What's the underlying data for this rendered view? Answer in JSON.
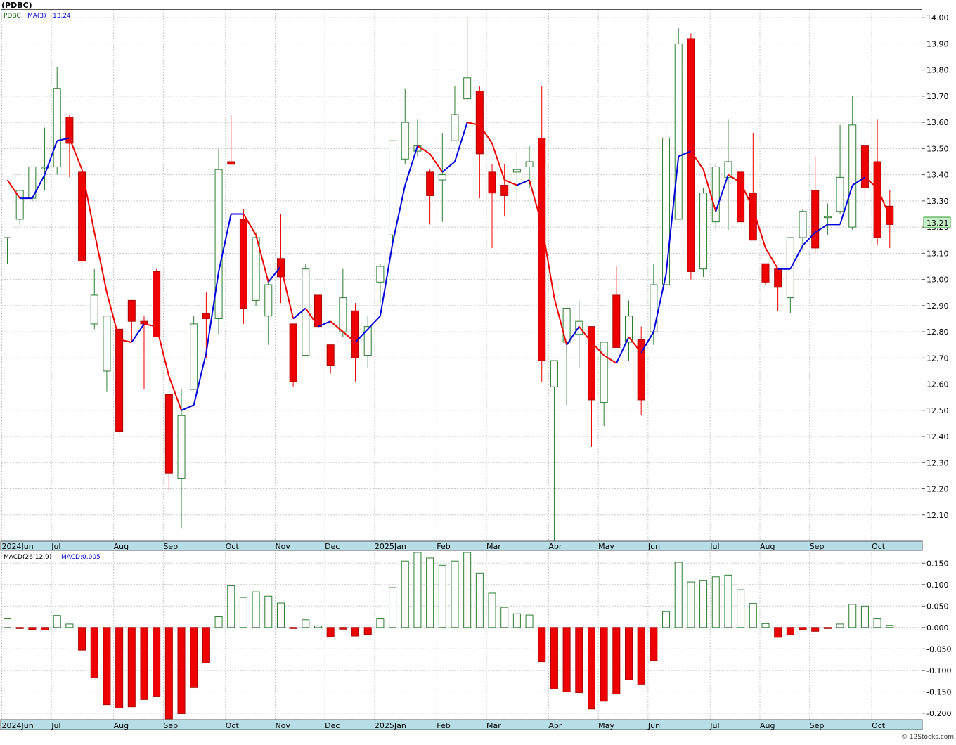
{
  "header": {
    "symbol_title": "(PDBC)"
  },
  "legend": {
    "symbol": "PDBC",
    "ma_label": "MA(3)",
    "ma_value": "13.24"
  },
  "macd_legend": {
    "params_label": "MACD(26,12,9)",
    "value_label": "MACD:0.005"
  },
  "last_price_label": "13.21",
  "watermark": "© 12Stocks.com",
  "colors": {
    "up": "#2e7d32",
    "down": "#ee0000",
    "ma_up": "#0000dd",
    "ma_down": "#ee0000",
    "axis_bar": "#b7dde6",
    "price_tag_bg": "#c8f0c8"
  },
  "chart_data": [
    {
      "type": "candlestick",
      "name": "price",
      "ylim": [
        12.0,
        14.03
      ],
      "y_ticks": [
        "14.00",
        "13.90",
        "13.80",
        "13.70",
        "13.60",
        "13.50",
        "13.40",
        "13.30",
        "13.20",
        "13.10",
        "13.00",
        "12.90",
        "12.80",
        "12.70",
        "12.60",
        "12.50",
        "12.40",
        "12.30",
        "12.20",
        "12.10"
      ],
      "x_labels": [
        {
          "label": "2024Jun",
          "i": 0
        },
        {
          "label": "Jul",
          "i": 4
        },
        {
          "label": "Aug",
          "i": 9
        },
        {
          "label": "Sep",
          "i": 13
        },
        {
          "label": "Oct",
          "i": 18
        },
        {
          "label": "Nov",
          "i": 22
        },
        {
          "label": "Dec",
          "i": 26
        },
        {
          "label": "2025Jan",
          "i": 30
        },
        {
          "label": "Feb",
          "i": 35
        },
        {
          "label": "Mar",
          "i": 39
        },
        {
          "label": "Apr",
          "i": 44
        },
        {
          "label": "May",
          "i": 48
        },
        {
          "label": "Jun",
          "i": 52
        },
        {
          "label": "Jul",
          "i": 57
        },
        {
          "label": "Aug",
          "i": 61
        },
        {
          "label": "Sep",
          "i": 65
        },
        {
          "label": "Oct",
          "i": 70
        }
      ],
      "candles": [
        [
          13.16,
          13.43,
          13.06,
          13.43
        ],
        [
          13.23,
          13.34,
          13.21,
          13.34
        ],
        [
          13.31,
          13.43,
          13.3,
          13.43
        ],
        [
          13.43,
          13.58,
          13.34,
          13.43
        ],
        [
          13.43,
          13.81,
          13.4,
          13.73
        ],
        [
          13.62,
          13.63,
          13.39,
          13.52
        ],
        [
          13.41,
          13.41,
          13.04,
          13.07
        ],
        [
          12.83,
          13.04,
          12.81,
          12.94
        ],
        [
          12.65,
          12.86,
          12.57,
          12.86
        ],
        [
          12.81,
          12.81,
          12.41,
          12.42
        ],
        [
          12.92,
          12.84,
          12.76,
          12.84
        ],
        [
          12.84,
          12.86,
          12.58,
          12.83
        ],
        [
          13.03,
          13.04,
          12.78,
          12.78
        ],
        [
          12.56,
          12.56,
          12.19,
          12.26
        ],
        [
          12.24,
          12.58,
          12.05,
          12.48
        ],
        [
          12.58,
          12.86,
          12.58,
          12.83
        ],
        [
          12.87,
          12.95,
          12.7,
          12.85
        ],
        [
          12.85,
          13.5,
          12.79,
          13.42
        ],
        [
          13.45,
          13.63,
          13.45,
          13.44
        ],
        [
          13.23,
          13.27,
          12.83,
          12.89
        ],
        [
          12.92,
          13.18,
          12.9,
          13.16
        ],
        [
          12.86,
          12.99,
          12.75,
          12.98
        ],
        [
          13.08,
          13.25,
          12.91,
          13.01
        ],
        [
          12.83,
          12.83,
          12.59,
          12.61
        ],
        [
          12.71,
          13.06,
          12.71,
          13.04
        ],
        [
          12.94,
          12.94,
          12.81,
          12.82
        ],
        [
          12.75,
          12.75,
          12.64,
          12.67
        ],
        [
          12.8,
          13.04,
          12.78,
          12.93
        ],
        [
          12.88,
          12.91,
          12.61,
          12.7
        ],
        [
          12.71,
          12.86,
          12.66,
          12.82
        ],
        [
          12.99,
          13.06,
          12.91,
          13.05
        ],
        [
          13.17,
          13.51,
          13.13,
          13.53
        ],
        [
          13.46,
          13.73,
          13.44,
          13.6
        ],
        [
          13.49,
          13.61,
          13.47,
          13.51
        ],
        [
          13.41,
          13.42,
          13.21,
          13.32
        ],
        [
          13.38,
          13.56,
          13.22,
          13.4
        ],
        [
          13.53,
          13.74,
          13.57,
          13.63
        ],
        [
          13.69,
          14.0,
          13.68,
          13.77
        ],
        [
          13.72,
          13.74,
          13.31,
          13.48
        ],
        [
          13.41,
          13.44,
          13.12,
          13.33
        ],
        [
          13.36,
          13.44,
          13.24,
          13.32
        ],
        [
          13.41,
          13.49,
          13.3,
          13.42
        ],
        [
          13.43,
          13.51,
          13.35,
          13.45
        ],
        [
          13.54,
          13.74,
          12.61,
          12.69
        ],
        [
          12.59,
          12.59,
          12.0,
          12.69
        ],
        [
          12.76,
          12.89,
          12.52,
          12.89
        ],
        [
          12.79,
          12.92,
          12.66,
          12.84
        ],
        [
          12.82,
          12.82,
          12.36,
          12.54
        ],
        [
          12.53,
          12.76,
          12.44,
          12.76
        ],
        [
          12.94,
          13.05,
          12.74,
          12.74
        ],
        [
          12.76,
          12.92,
          12.69,
          12.86
        ],
        [
          12.77,
          12.82,
          12.48,
          12.54
        ],
        [
          12.8,
          13.06,
          12.75,
          12.98
        ],
        [
          12.98,
          13.6,
          12.94,
          13.54
        ],
        [
          13.23,
          13.96,
          13.31,
          13.9
        ],
        [
          13.92,
          13.94,
          13.0,
          13.03
        ],
        [
          13.04,
          13.35,
          13.01,
          13.33
        ],
        [
          13.22,
          13.44,
          13.19,
          13.43
        ],
        [
          13.39,
          13.61,
          13.19,
          13.45
        ],
        [
          13.41,
          13.41,
          13.22,
          13.22
        ],
        [
          13.33,
          13.56,
          13.17,
          13.15
        ],
        [
          13.06,
          13.06,
          12.98,
          12.99
        ],
        [
          13.04,
          13.03,
          12.88,
          12.97
        ],
        [
          12.93,
          13.16,
          12.87,
          13.16
        ],
        [
          13.16,
          13.27,
          13.11,
          13.26
        ],
        [
          13.34,
          13.47,
          13.1,
          13.12
        ],
        [
          13.24,
          13.29,
          13.17,
          13.24
        ],
        [
          13.26,
          13.59,
          13.25,
          13.39
        ],
        [
          13.2,
          13.7,
          13.19,
          13.59
        ],
        [
          13.51,
          13.53,
          13.28,
          13.35
        ],
        [
          13.45,
          13.61,
          13.13,
          13.16
        ],
        [
          13.28,
          13.34,
          13.12,
          13.21
        ]
      ],
      "ma3": [
        13.38,
        13.31,
        13.31,
        13.4,
        13.53,
        13.54,
        13.42,
        13.18,
        12.95,
        12.77,
        12.76,
        12.83,
        12.82,
        12.63,
        12.5,
        12.52,
        12.72,
        13.03,
        13.25,
        13.25,
        13.17,
        12.99,
        13.05,
        12.85,
        12.89,
        12.82,
        12.84,
        12.8,
        12.76,
        12.81,
        12.86,
        13.14,
        13.36,
        13.51,
        13.48,
        13.41,
        13.45,
        13.6,
        13.59,
        13.52,
        13.38,
        13.36,
        13.38,
        13.21,
        12.93,
        12.75,
        12.82,
        12.76,
        12.71,
        12.68,
        12.78,
        12.72,
        12.8,
        13.02,
        13.47,
        13.49,
        13.42,
        13.26,
        13.4,
        13.37,
        13.27,
        13.12,
        13.04,
        13.04,
        13.13,
        13.18,
        13.21,
        13.21,
        13.36,
        13.39,
        13.35,
        13.24
      ]
    },
    {
      "type": "bar",
      "name": "macd_histogram",
      "ylim": [
        -0.215,
        0.175
      ],
      "y_ticks": [
        "0.150",
        "0.100",
        "0.050",
        "0.000",
        "-0.050",
        "-0.100",
        "-0.150",
        "-0.200"
      ],
      "x_labels": [
        {
          "label": "2024Jun",
          "i": 0
        },
        {
          "label": "Jul",
          "i": 4
        },
        {
          "label": "Aug",
          "i": 9
        },
        {
          "label": "Sep",
          "i": 13
        },
        {
          "label": "Oct",
          "i": 18
        },
        {
          "label": "Nov",
          "i": 22
        },
        {
          "label": "Dec",
          "i": 26
        },
        {
          "label": "2025Jan",
          "i": 30
        },
        {
          "label": "Feb",
          "i": 35
        },
        {
          "label": "Mar",
          "i": 39
        },
        {
          "label": "Apr",
          "i": 44
        },
        {
          "label": "May",
          "i": 48
        },
        {
          "label": "Jun",
          "i": 52
        },
        {
          "label": "Jul",
          "i": 57
        },
        {
          "label": "Aug",
          "i": 61
        },
        {
          "label": "Sep",
          "i": 65
        },
        {
          "label": "Oct",
          "i": 70
        }
      ],
      "values": [
        0.02,
        -0.002,
        -0.005,
        -0.006,
        0.028,
        0.008,
        -0.053,
        -0.117,
        -0.18,
        -0.188,
        -0.185,
        -0.168,
        -0.16,
        -0.213,
        -0.201,
        -0.14,
        -0.083,
        0.025,
        0.097,
        0.07,
        0.083,
        0.073,
        0.057,
        -0.002,
        0.018,
        0.004,
        -0.022,
        -0.004,
        -0.02,
        -0.016,
        0.02,
        0.093,
        0.155,
        0.175,
        0.162,
        0.145,
        0.155,
        0.175,
        0.127,
        0.08,
        0.047,
        0.032,
        0.029,
        -0.08,
        -0.143,
        -0.15,
        -0.152,
        -0.19,
        -0.172,
        -0.155,
        -0.122,
        -0.132,
        -0.077,
        0.037,
        0.152,
        0.106,
        0.11,
        0.118,
        0.122,
        0.088,
        0.056,
        0.009,
        -0.023,
        -0.017,
        -0.005,
        -0.009,
        -0.001,
        0.008,
        0.054,
        0.05,
        0.02,
        0.005
      ]
    }
  ]
}
